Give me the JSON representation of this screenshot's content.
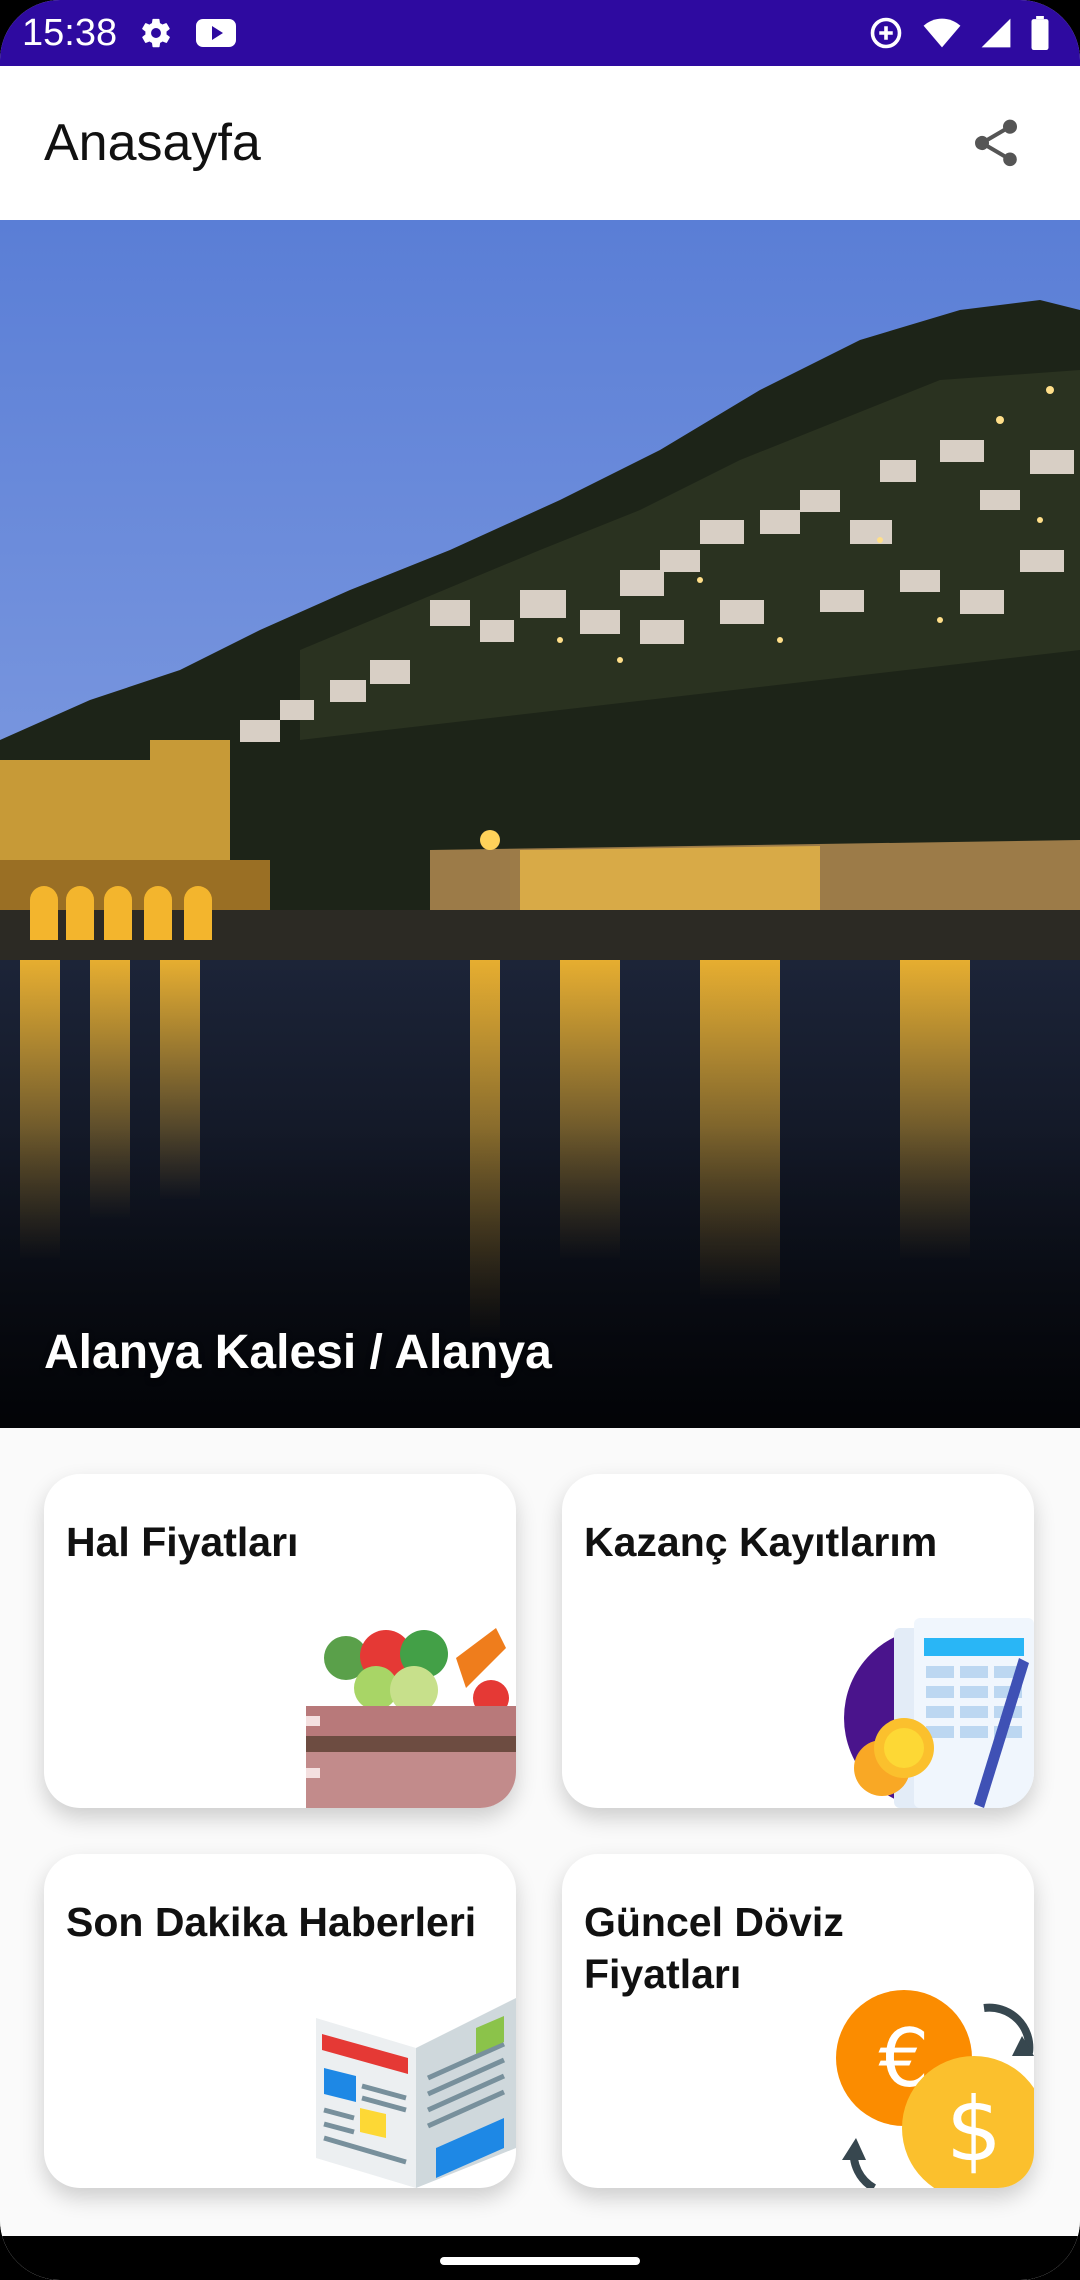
{
  "status_bar": {
    "time": "15:38",
    "icons_left": [
      "gear-icon",
      "youtube-icon"
    ],
    "icons_right": [
      "data-saver-icon",
      "wifi-icon",
      "signal-icon",
      "battery-icon"
    ],
    "color": "#2e0aa0"
  },
  "app_bar": {
    "title": "Anasayfa",
    "share_icon": "share-icon"
  },
  "hero": {
    "caption": "Alanya Kalesi / Alanya"
  },
  "cards": [
    {
      "title": "Hal Fiyatları",
      "icon": "vegetable-crate-icon"
    },
    {
      "title": "Kazanç Kayıtlarım",
      "icon": "ledger-coins-icon"
    },
    {
      "title": "Son Dakika Haberleri",
      "icon": "newspaper-icon"
    },
    {
      "title": "Güncel Döviz Fiyatları",
      "icon": "currency-exchange-icon"
    }
  ]
}
